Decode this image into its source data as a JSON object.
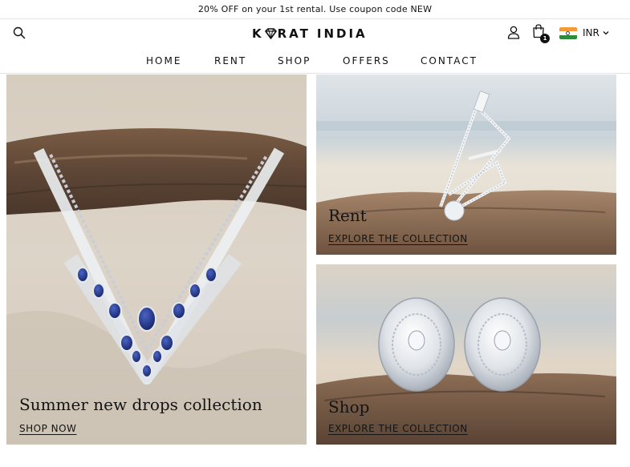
{
  "announcement": "20% OFF on your 1st rental. Use coupon code NEW",
  "header": {
    "logo": {
      "k": "K",
      "rest": "RAT",
      "india": "INDIA"
    },
    "cart_count": "1",
    "currency": "INR"
  },
  "nav": {
    "items": [
      {
        "label": "HOME"
      },
      {
        "label": "RENT"
      },
      {
        "label": "SHOP"
      },
      {
        "label": "OFFERS"
      },
      {
        "label": "CONTACT"
      }
    ]
  },
  "tiles": {
    "summer": {
      "title": "Summer new drops collection",
      "link": "SHOP NOW"
    },
    "rent": {
      "title": "Rent",
      "link": "EXPLORE THE COLLECTION"
    },
    "shop": {
      "title": "Shop",
      "link": "EXPLORE THE COLLECTION"
    }
  },
  "icons": [
    "search-icon",
    "account-icon",
    "cart-icon",
    "india-flag-icon",
    "chevron-down-icon",
    "logo-diamond-icon"
  ],
  "colors": {
    "text": "#111111",
    "sand": "#d9d0c3",
    "driftwood": "#8a6a4e",
    "sapphire": "#1d2f7a",
    "flag_saffron": "#f49a3a",
    "flag_green": "#2e8b3a"
  }
}
